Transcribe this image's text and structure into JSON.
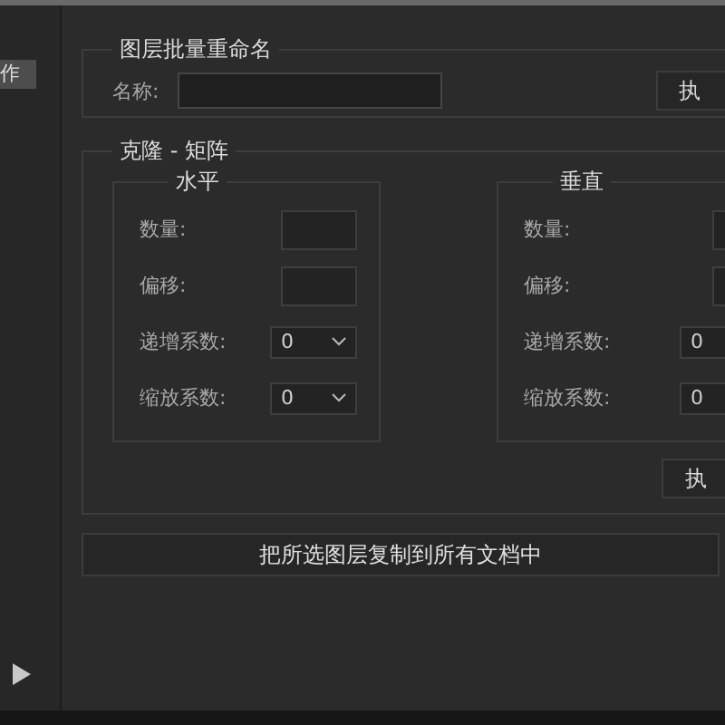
{
  "sidebar": {
    "items": [
      {
        "label": "作",
        "selected": true
      }
    ]
  },
  "rename": {
    "title": "图层批量重命名",
    "name_label": "名称:",
    "execute_button": "执"
  },
  "clone": {
    "title": "克隆 - 矩阵",
    "groups": [
      {
        "title": "水平",
        "rows": [
          {
            "kind": "input",
            "label": "数量:"
          },
          {
            "kind": "input",
            "label": "偏移:"
          },
          {
            "kind": "select",
            "label": "递增系数:",
            "value": "0"
          },
          {
            "kind": "select",
            "label": "缩放系数:",
            "value": "0"
          }
        ]
      },
      {
        "title": "垂直",
        "rows": [
          {
            "kind": "input",
            "label": "数量:"
          },
          {
            "kind": "input",
            "label": "偏移:"
          },
          {
            "kind": "select",
            "label": "递增系数:",
            "value": "0"
          },
          {
            "kind": "select",
            "label": "缩放系数:",
            "value": "0"
          }
        ]
      }
    ],
    "execute_button": "执"
  },
  "copy_button": "把所选图层复制到所有文档中"
}
